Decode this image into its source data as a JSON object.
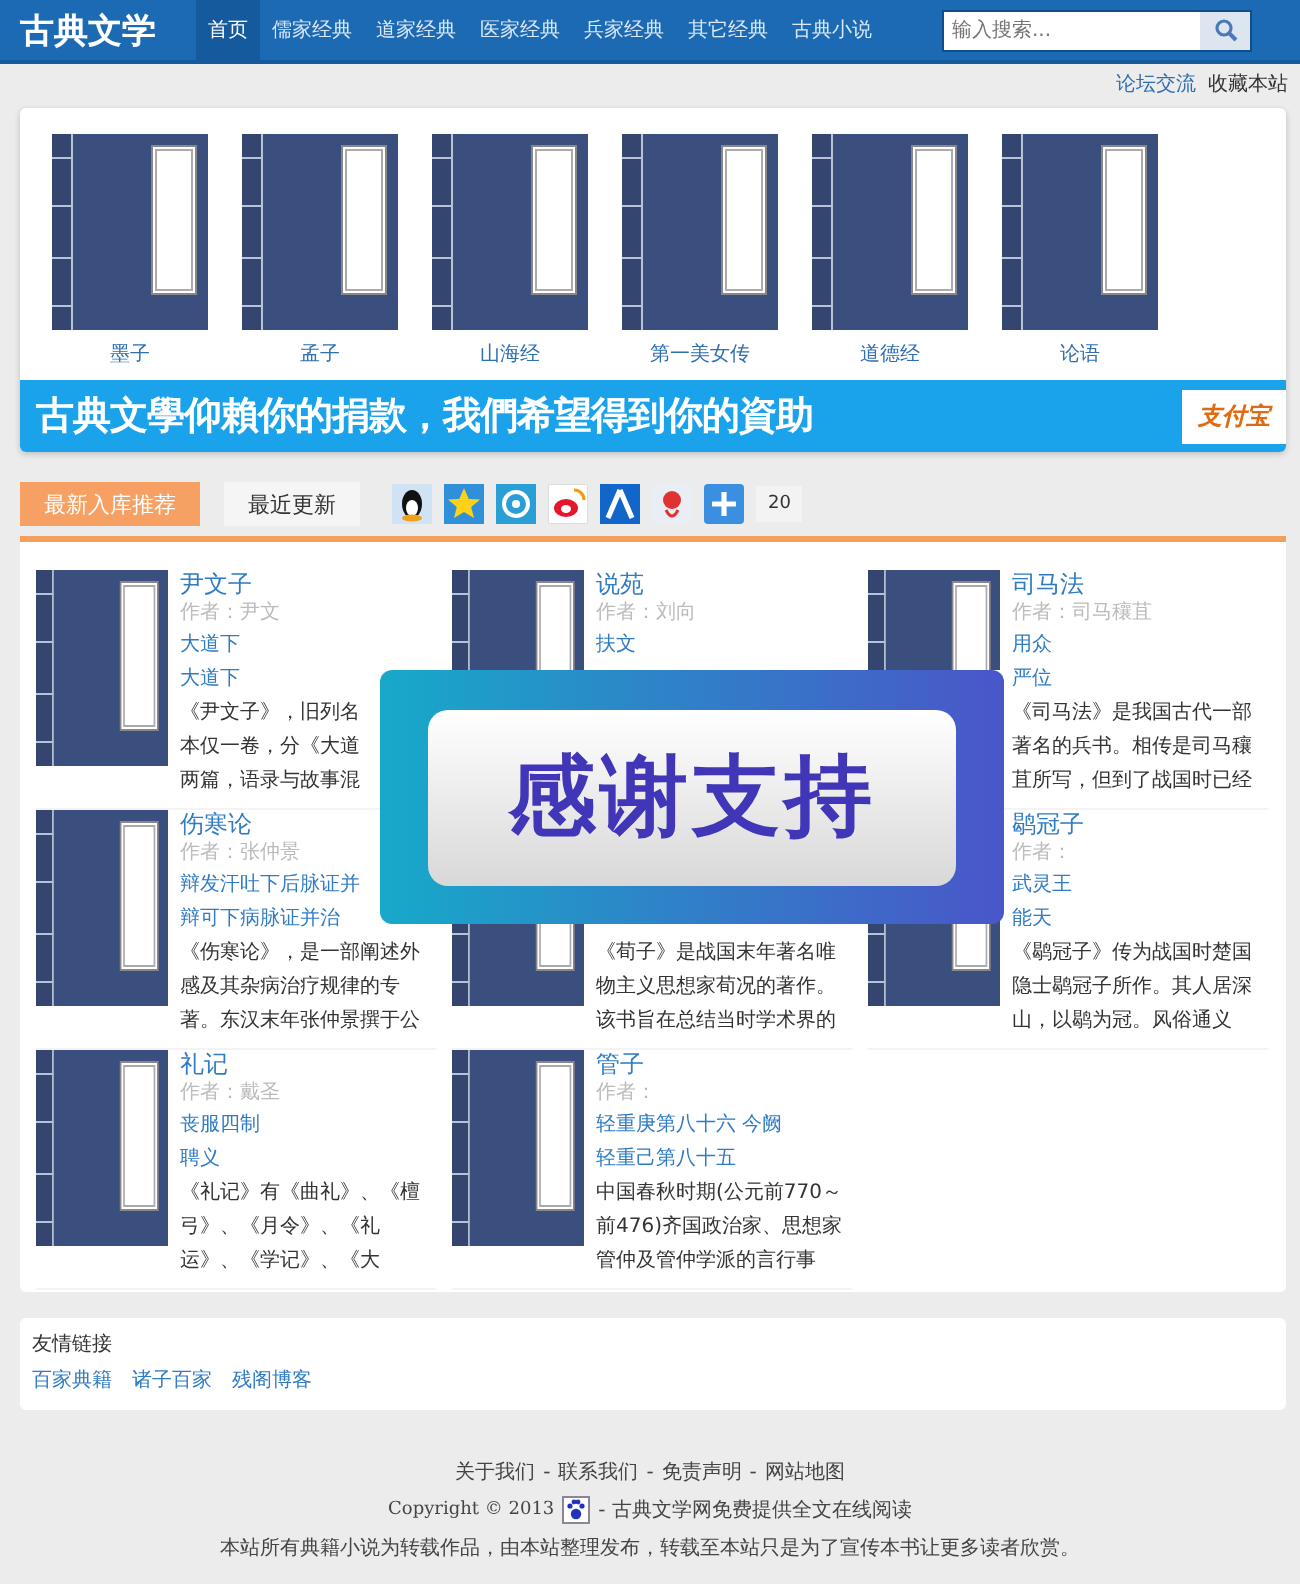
{
  "header": {
    "logo": "古典文学",
    "nav": [
      {
        "label": "首页",
        "selected": true
      },
      {
        "label": "儒家经典",
        "selected": false
      },
      {
        "label": "道家经典",
        "selected": false
      },
      {
        "label": "医家经典",
        "selected": false
      },
      {
        "label": "兵家经典",
        "selected": false
      },
      {
        "label": "其它经典",
        "selected": false
      },
      {
        "label": "古典小说",
        "selected": false
      }
    ],
    "search": {
      "placeholder": "输入搜索..."
    }
  },
  "top_links": [
    "论坛交流",
    "收藏本站"
  ],
  "featured": {
    "books": [
      "墨子",
      "孟子",
      "山海经",
      "第一美女传",
      "道德经",
      "论语"
    ],
    "banner": {
      "text": "古典文學仰賴你的捐款，我們希望得到你的資助",
      "logo": "支付宝"
    }
  },
  "tabs": [
    {
      "label": "最新入库推荐",
      "selected": true
    },
    {
      "label": "最近更新",
      "selected": false
    }
  ],
  "share_count": "20",
  "cards": [
    {
      "title": "尹文子",
      "author": "作者：尹文",
      "links": [
        "大道下",
        "大道下"
      ],
      "desc": [
        "《尹文子》，旧列名",
        "本仅一卷，分《大道",
        "两篇，语录与故事混"
      ]
    },
    {
      "title": "说苑",
      "author": "作者：刘向",
      "links": [
        "扶文"
      ]
    },
    {
      "title": "司马法",
      "author": "作者：司马穰苴",
      "links": [
        "用众",
        "严位"
      ],
      "desc": [
        "《司马法》是我国古代一部",
        "著名的兵书。相传是司马穰",
        "苴所写，但到了战国时已经"
      ]
    },
    {
      "title": "伤寒论",
      "author": "作者：张仲景",
      "links": [
        "辩发汗吐下后脉证并",
        "辩可下病脉证并治"
      ],
      "desc": [
        "《伤寒论》，是一部阐述外",
        "感及其杂病治疗规律的专",
        "著。东汉末年张仲景撰于公"
      ]
    },
    {
      "desc": [
        "《荀子》是战国末年著名唯",
        "物主义思想家荀况的著作。",
        "该书旨在总结当时学术界的"
      ]
    },
    {
      "title": "鹖冠子",
      "author": "作者：",
      "links": [
        "武灵王",
        "能天"
      ],
      "desc": [
        "《鹖冠子》传为战国时楚国",
        "隐士鹖冠子所作。其人居深",
        "山，以鹖为冠。风俗通义"
      ]
    },
    {
      "title": "礼记",
      "author": "作者：戴圣",
      "links": [
        "丧服四制",
        "聘义"
      ],
      "desc": [
        "《礼记》有《曲礼》、《檀",
        "弓》、《月令》、《礼",
        "运》、《学记》、《大"
      ]
    },
    {
      "title": "管子",
      "author": "作者：",
      "links": [
        "轻重庚第八十六 今阙",
        "轻重己第八十五"
      ],
      "desc": [
        "中国春秋时期(公元前770～",
        "前476)齐国政治家、思想家",
        "管仲及管仲学派的言行事"
      ]
    }
  ],
  "friend_links": {
    "title": "友情链接",
    "links": [
      "百家典籍",
      "诸子百家",
      "残阁博客"
    ]
  },
  "footer": {
    "links": [
      "关于我们",
      "联系我们",
      "免责声明",
      "网站地图"
    ],
    "separator": "-",
    "copyright": "Copyright © 2013",
    "site_note": "- 古典文学网免费提供全文在线阅读",
    "notice": "本站所有典籍小说为转载作品，由本站整理发布，转载至本站只是为了宣传本书让更多读者欣赏。"
  },
  "popup": {
    "text": "感谢支持"
  }
}
